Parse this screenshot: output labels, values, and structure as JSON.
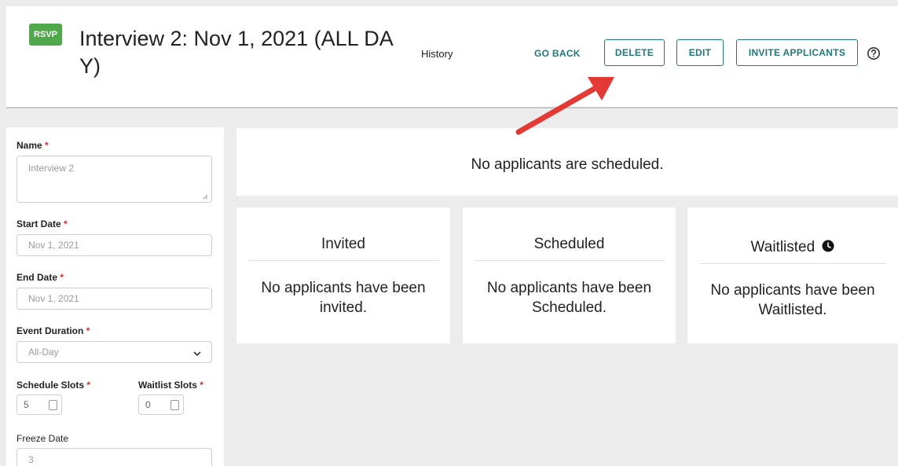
{
  "header": {
    "badge": "RSVP",
    "title": "Interview 2: Nov 1, 2021 (ALL DAY)",
    "history": "History",
    "go_back": "GO BACK",
    "delete": "DELETE",
    "edit": "EDIT",
    "invite": "INVITE APPLICANTS"
  },
  "form": {
    "name_label": "Name",
    "name_value": "Interview 2",
    "start_label": "Start Date",
    "start_value": "Nov 1, 2021",
    "end_label": "End Date",
    "end_value": "Nov 1, 2021",
    "duration_label": "Event Duration",
    "duration_value": "All-Day",
    "slots_label": "Schedule Slots",
    "slots_value": "5",
    "waitlist_label": "Waitlist Slots",
    "waitlist_value": "0",
    "freeze_label": "Freeze Date",
    "freeze_value": "3",
    "required_mark": "*"
  },
  "main": {
    "scheduled_summary": "No applicants are scheduled.",
    "invited_title": "Invited",
    "invited_msg": "No applicants have been invited.",
    "scheduled_title": "Scheduled",
    "scheduled_msg": "No applicants have been Scheduled.",
    "waitlisted_title": "Waitlisted",
    "waitlisted_msg": "No applicants have been Waitlisted."
  },
  "colors": {
    "accent": "#1e7a7a",
    "badge": "#4fa84a",
    "arrow": "#e53935"
  }
}
